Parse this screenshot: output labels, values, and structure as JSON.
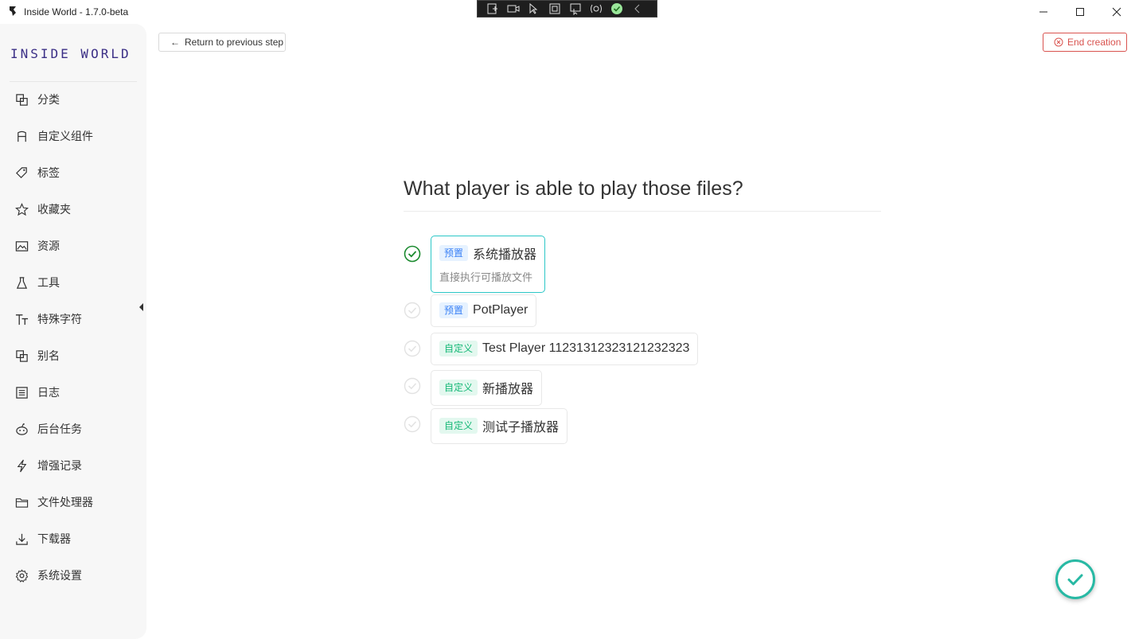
{
  "window": {
    "title": "Inside World - 1.7.0-beta"
  },
  "sidebar": {
    "logo": "INSIDE WORLD",
    "items": [
      {
        "label": "分类",
        "icon": "copy-icon"
      },
      {
        "label": "自定义组件",
        "icon": "component-icon"
      },
      {
        "label": "标签",
        "icon": "tags-icon"
      },
      {
        "label": "收藏夹",
        "icon": "star-icon"
      },
      {
        "label": "资源",
        "icon": "image-icon"
      },
      {
        "label": "工具",
        "icon": "flask-icon"
      },
      {
        "label": "特殊字符",
        "icon": "text-size-icon"
      },
      {
        "label": "别名",
        "icon": "copy-icon"
      },
      {
        "label": "日志",
        "icon": "list-icon"
      },
      {
        "label": "后台任务",
        "icon": "robot-icon"
      },
      {
        "label": "增强记录",
        "icon": "bolt-icon"
      },
      {
        "label": "文件处理器",
        "icon": "folder-icon"
      },
      {
        "label": "下载器",
        "icon": "download-icon"
      },
      {
        "label": "系统设置",
        "icon": "gear-icon"
      }
    ]
  },
  "header": {
    "return_label": "Return to previous step",
    "end_label": "End creation"
  },
  "main": {
    "question": "What player is able to play those files?",
    "options": [
      {
        "tag": "预置",
        "tag_type": "preset",
        "name": "系统播放器",
        "desc": "直接执行可播放文件",
        "selected": true
      },
      {
        "tag": "预置",
        "tag_type": "preset",
        "name": "PotPlayer",
        "desc": "",
        "selected": false
      },
      {
        "tag": "自定义",
        "tag_type": "custom",
        "name": "Test Player 11231312323121232323",
        "desc": "",
        "selected": false
      },
      {
        "tag": "自定义",
        "tag_type": "custom",
        "name": "新播放器",
        "desc": "",
        "selected": false
      },
      {
        "tag": "自定义",
        "tag_type": "custom",
        "name": "测试子播放器",
        "desc": "",
        "selected": false
      }
    ]
  },
  "colors": {
    "accent": "#2cc7c7",
    "danger": "#d9534f",
    "brand": "#3b2f86",
    "success": "#28b9a4"
  }
}
